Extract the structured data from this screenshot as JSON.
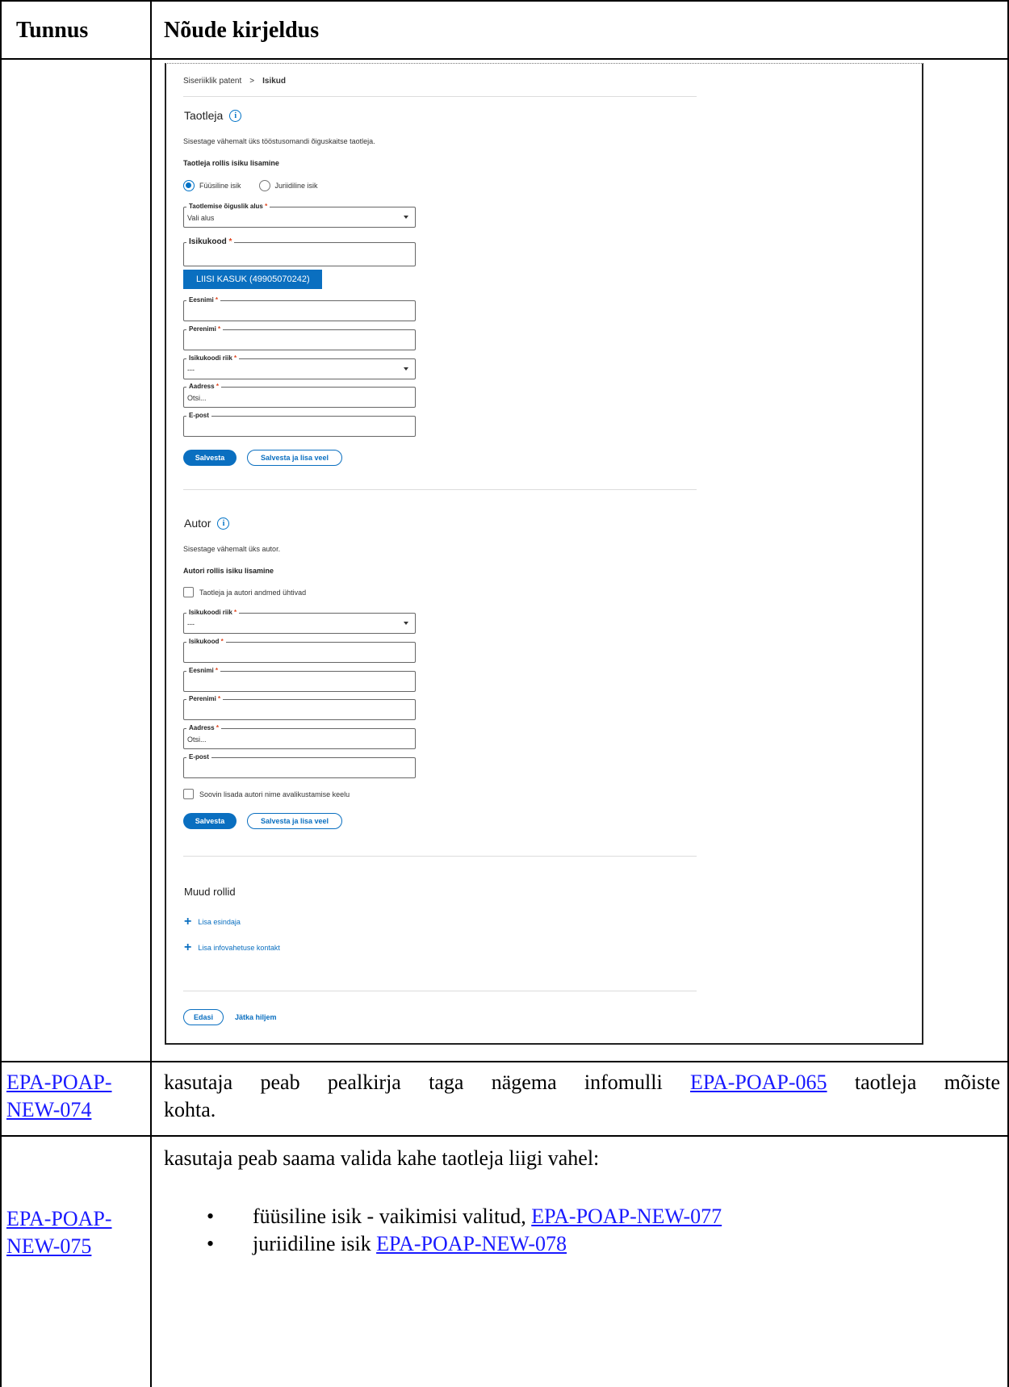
{
  "table": {
    "header": {
      "col1": "Tunnus",
      "col2": "Nõude kirjeldus"
    },
    "rows": [
      {
        "id_line1": "EPA-POAP-",
        "id_line2": "NEW-074",
        "text_before": "kasutaja peab pealkirja taga nägema infomulli ",
        "text_link": "EPA-POAP-065",
        "text_after": " taotleja mõiste",
        "text_line2": "kohta."
      },
      {
        "id_line1": "EPA-POAP-",
        "id_line2": "NEW-075",
        "intro": "kasutaja peab saama valida kahe taotleja liigi vahel:",
        "bullets": [
          {
            "text": "füüsiline isik - vaikimisi valitud, ",
            "link": "EPA-POAP-NEW-077"
          },
          {
            "text": "juriidiline isik ",
            "link": "EPA-POAP-NEW-078"
          }
        ]
      }
    ]
  },
  "ui": {
    "breadcrumb": {
      "parent": "Siseriiklik patent",
      "separator": ">",
      "current": "Isikud"
    },
    "applicant": {
      "title": "Taotleja",
      "info_icon": "info-icon",
      "hint": "Sisestage vähemalt üks tööstusomandi õiguskaitse taotleja.",
      "subheading": "Taotleja rollis isiku lisamine",
      "radio_natural": "Füüsiline isik",
      "radio_legal": "Juriidiline isik",
      "selected_radio": "Füüsiline isik",
      "legal_basis": {
        "label": "Taotlemise õiguslik alus",
        "required": "*",
        "value": "Vali alus"
      },
      "id_code": {
        "label": "Isikukood",
        "required": "*"
      },
      "suggestion": "LIISI KASUK (49905070242)",
      "first_name": {
        "label": "Eesnimi",
        "required": "*"
      },
      "last_name": {
        "label": "Perenimi",
        "required": "*"
      },
      "id_country": {
        "label": "Isikukoodi riik",
        "required": "*",
        "value": "---"
      },
      "address": {
        "label": "Aadress",
        "required": "*",
        "value": "Otsi..."
      },
      "email": {
        "label": "E-post"
      },
      "save": "Salvesta",
      "save_add": "Salvesta ja lisa veel"
    },
    "author": {
      "title": "Autor",
      "hint": "Sisestage vähemalt üks autor.",
      "subheading": "Autori rollis isiku lisamine",
      "same_data_checkbox": "Taotleja ja autori andmed ühtivad",
      "id_country": {
        "label": "Isikukoodi riik",
        "required": "*",
        "value": "---"
      },
      "id_code": {
        "label": "Isikukood",
        "required": "*"
      },
      "first_name": {
        "label": "Eesnimi",
        "required": "*"
      },
      "last_name": {
        "label": "Perenimi",
        "required": "*"
      },
      "address": {
        "label": "Aadress",
        "required": "*",
        "value": "Otsi..."
      },
      "email": {
        "label": "E-post"
      },
      "publish_ban_checkbox": "Soovin lisada autori nime avalikustamise keelu",
      "save": "Salvesta",
      "save_add": "Salvesta ja lisa veel"
    },
    "other_roles": {
      "title": "Muud rollid",
      "add_representative": "Lisa esindaja",
      "add_contact": "Lisa infovahetuse kontakt"
    },
    "footer": {
      "next": "Edasi",
      "later": "Jätka hiljem"
    }
  }
}
